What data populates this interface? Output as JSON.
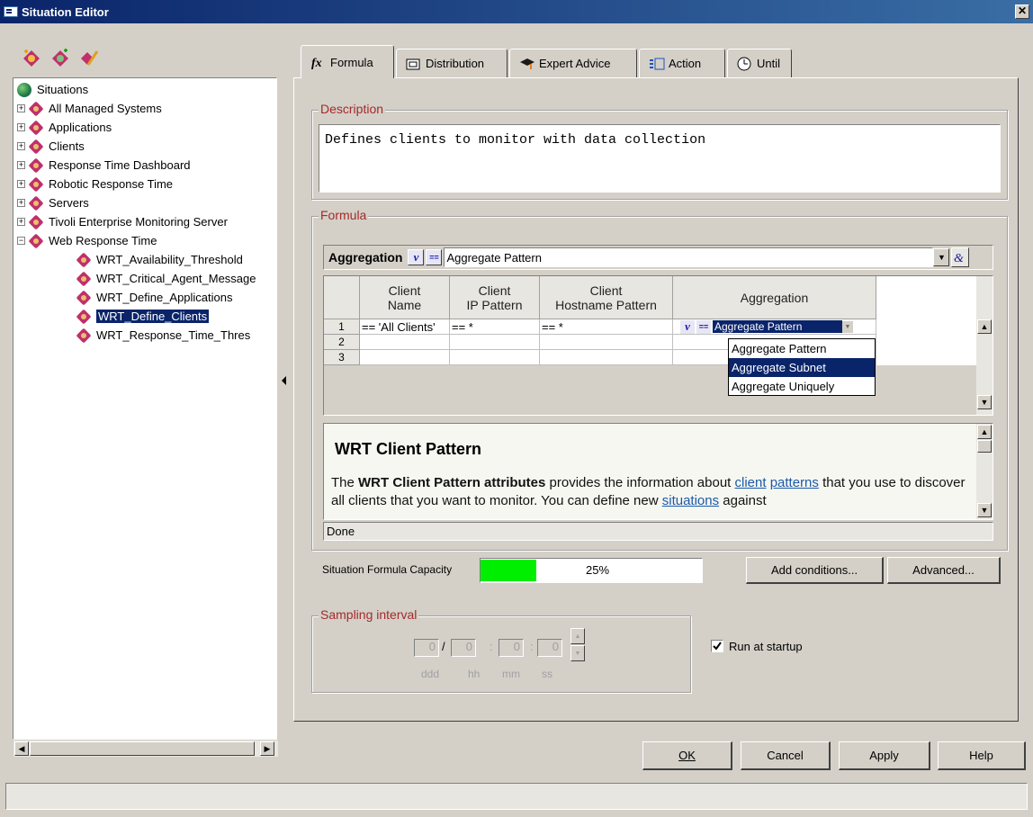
{
  "window": {
    "title": "Situation Editor",
    "close_glyph": "✕"
  },
  "tree": {
    "root_label": "Situations",
    "items": [
      {
        "label": "All Managed Systems",
        "expander": "+"
      },
      {
        "label": "Applications",
        "expander": "+"
      },
      {
        "label": "Clients",
        "expander": "+"
      },
      {
        "label": "Response Time Dashboard",
        "expander": "+"
      },
      {
        "label": "Robotic Response Time",
        "expander": "+"
      },
      {
        "label": "Servers",
        "expander": "+"
      },
      {
        "label": "Tivoli Enterprise Monitoring Server",
        "expander": "+"
      },
      {
        "label": "Web Response Time",
        "expander": "−"
      }
    ],
    "children": [
      {
        "label": "WRT_Availability_Threshold"
      },
      {
        "label": "WRT_Critical_Agent_Message"
      },
      {
        "label": "WRT_Define_Applications"
      },
      {
        "label": "WRT_Define_Clients",
        "selected": true
      },
      {
        "label": "WRT_Response_Time_Thres"
      }
    ]
  },
  "tabs": [
    {
      "label": "Formula",
      "icon": "fx-icon",
      "active": true
    },
    {
      "label": "Distribution",
      "icon": "distribution-icon"
    },
    {
      "label": "Expert Advice",
      "icon": "graduation-cap-icon"
    },
    {
      "label": "Action",
      "icon": "action-icon"
    },
    {
      "label": "Until",
      "icon": "until-icon"
    }
  ],
  "description": {
    "label": "Description",
    "text": "Defines clients to monitor with data collection"
  },
  "formula": {
    "label": "Formula",
    "aggregation_label": "Aggregation",
    "aggregation_value": "Aggregate Pattern",
    "columns": [
      "Client\nName",
      "Client\nIP Pattern",
      "Client\nHostname Pattern",
      "Aggregation"
    ],
    "rows": [
      {
        "num": "1",
        "client_name": "== 'All Clients'",
        "ip_pattern": "== *",
        "hostname_pattern": "== *",
        "aggregation": "Aggregate Pattern"
      },
      {
        "num": "2",
        "client_name": "",
        "ip_pattern": "",
        "hostname_pattern": "",
        "aggregation": ""
      },
      {
        "num": "3",
        "client_name": "",
        "ip_pattern": "",
        "hostname_pattern": "",
        "aggregation": ""
      }
    ],
    "dropdown_options": [
      "Aggregate Pattern",
      "Aggregate Subnet",
      "Aggregate Uniquely"
    ],
    "dropdown_highlighted": "Aggregate Subnet"
  },
  "help": {
    "title": "WRT Client Pattern",
    "text_prefix": "The ",
    "text_bold": "WRT Client Pattern attributes",
    "text_mid1": " provides the information about ",
    "link1": "client",
    "text_sp": " ",
    "link2": "patterns",
    "text_mid2": " that you use to discover all clients that you want to monitor. You can define new ",
    "link3": "situations",
    "text_end": " against",
    "status": "Done"
  },
  "capacity": {
    "label": "Situation Formula Capacity",
    "percent_text": "25%",
    "percent": 25,
    "fill_color": "#00ee00"
  },
  "buttons": {
    "add_conditions": "Add conditions...",
    "advanced": "Advanced...",
    "ok": "OK",
    "cancel": "Cancel",
    "apply": "Apply",
    "help": "Help"
  },
  "sampling": {
    "label": "Sampling interval",
    "ddd": "0",
    "hh": "0",
    "mm": "0",
    "ss": "0",
    "sep1": "/",
    "sep2": ":",
    "sep3": ":",
    "units": [
      "ddd",
      "hh",
      "mm",
      "ss"
    ]
  },
  "run_at_startup": {
    "label": "Run at startup",
    "checked": true
  }
}
